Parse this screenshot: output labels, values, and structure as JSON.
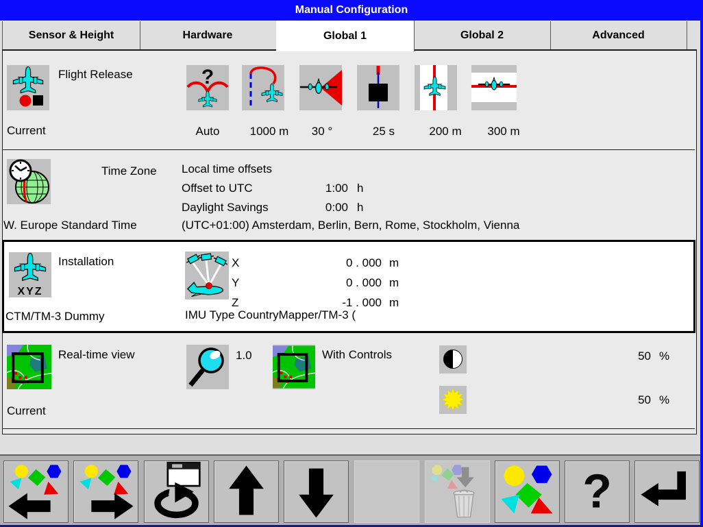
{
  "window": {
    "title": "Manual Configuration"
  },
  "tabs": [
    {
      "label": "Sensor & Height",
      "active": false
    },
    {
      "label": "Hardware",
      "active": false
    },
    {
      "label": "Global 1",
      "active": true
    },
    {
      "label": "Global 2",
      "active": false
    },
    {
      "label": "Advanced",
      "active": false
    }
  ],
  "flight_release": {
    "icon": "airplane-release-icon",
    "title": "Flight Release",
    "status": "Current",
    "params": [
      {
        "icon": "auto-release-icon",
        "value": "Auto"
      },
      {
        "icon": "turn-radius-icon",
        "value": "1000 m"
      },
      {
        "icon": "field-of-view-icon",
        "value": "30 °"
      },
      {
        "icon": "release-interval-icon",
        "value": "25 s"
      },
      {
        "icon": "across-track-icon",
        "value": "200 m"
      },
      {
        "icon": "along-track-icon",
        "value": "300 m"
      }
    ]
  },
  "time_zone": {
    "icon": "globe-clock-icon",
    "title": "Time Zone",
    "status": "W. Europe Standard Time",
    "offsets_heading": "Local time offsets",
    "offset_utc_label": "Offset to UTC",
    "offset_utc_value": "1:00",
    "offset_utc_unit": "h",
    "daylight_label": "Daylight Savings",
    "daylight_value": "0:00",
    "daylight_unit": "h",
    "description": "(UTC+01:00) Amsterdam, Berlin, Bern, Rome, Stockholm, Vienna"
  },
  "installation": {
    "icon": "airplane-xyz-icon",
    "offset_icon": "gps-lever-arm-icon",
    "title": "Installation",
    "status": "CTM/TM-3 Dummy",
    "imu_type": "IMU Type CountryMapper/TM-3 (",
    "lever_arms": [
      {
        "axis": "X",
        "value": "0 . 000",
        "unit": "m"
      },
      {
        "axis": "Y",
        "value": "0 . 000",
        "unit": "m"
      },
      {
        "axis": "Z",
        "value": "-1 . 000",
        "unit": "m"
      }
    ]
  },
  "realtime_view": {
    "icon": "map-view-icon",
    "zoom_icon": "magnifier-icon",
    "mode_icon": "map-view-icon",
    "contrast_icon": "contrast-icon",
    "brightness_icon": "brightness-sun-icon",
    "title": "Real-time view",
    "status": "Current",
    "zoom_value": "1.0",
    "mode": "With Controls",
    "contrast_value": "50",
    "contrast_unit": "%",
    "brightness_value": "50",
    "brightness_unit": "%"
  },
  "toolbar": {
    "buttons": [
      {
        "name": "navigate-back",
        "icon": "shapes-arrow-left-icon",
        "enabled": true
      },
      {
        "name": "navigate-forward",
        "icon": "shapes-arrow-right-icon",
        "enabled": true
      },
      {
        "name": "refresh-window",
        "icon": "window-redo-icon",
        "enabled": true
      },
      {
        "name": "move-up",
        "icon": "arrow-up-icon",
        "enabled": true
      },
      {
        "name": "move-down",
        "icon": "arrow-down-icon",
        "enabled": true
      },
      {
        "name": "blank",
        "icon": "none",
        "enabled": false
      },
      {
        "name": "delete",
        "icon": "trash-icon",
        "enabled": false
      },
      {
        "name": "shapes",
        "icon": "shapes-icon",
        "enabled": true
      },
      {
        "name": "help",
        "icon": "question-mark-icon",
        "enabled": true
      },
      {
        "name": "enter",
        "icon": "enter-arrow-icon",
        "enabled": true
      }
    ]
  },
  "glyphs": {
    "question": "?",
    "xyz": "XYZ"
  },
  "colors": {
    "titlebar": "#0a0afe",
    "accent_red": "#e80000",
    "accent_cyan": "#00e6e6",
    "accent_blue": "#0000e0",
    "selected_bg": "#ffffff",
    "tile_bg": "#c0c0c0",
    "toolbar_bg": "#b1b1b1"
  }
}
